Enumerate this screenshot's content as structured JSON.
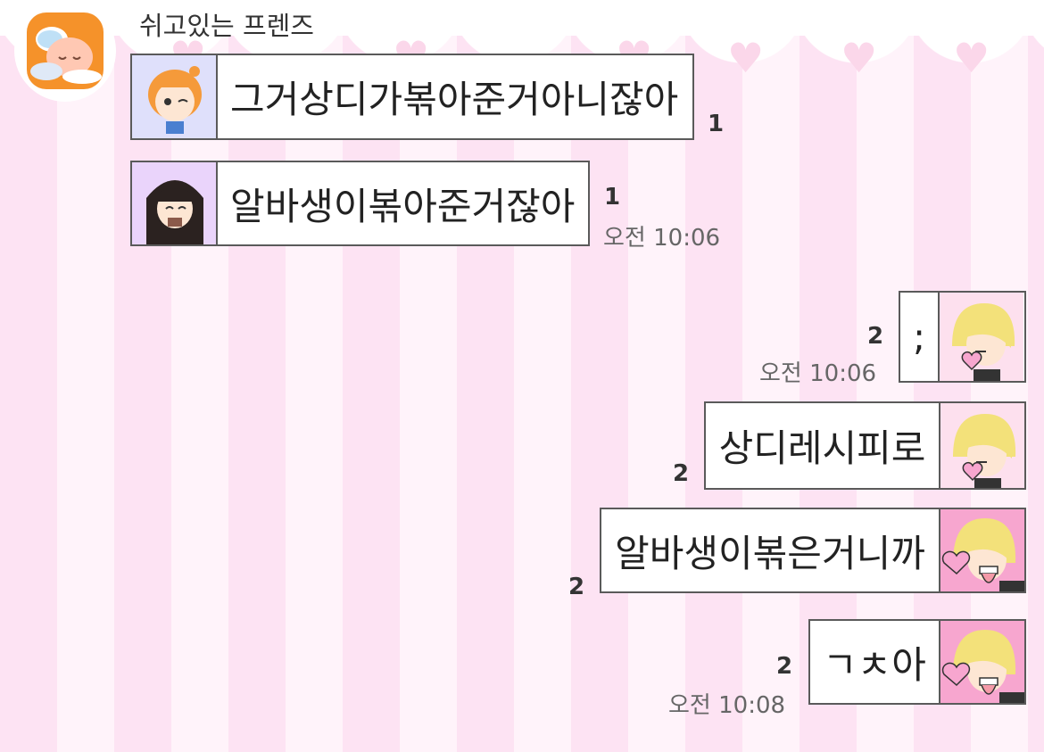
{
  "chat": {
    "sender_name": "쉬고있는 프렌즈",
    "messages": [
      {
        "text": "그거상디가볶아준거아니잖아",
        "count": "1",
        "time": ""
      },
      {
        "text": "알바생이볶아준거잖아",
        "count": "1",
        "time": "오전 10:06"
      },
      {
        "text": ";",
        "count": "2",
        "time": "오전 10:06"
      },
      {
        "text": "상디레시피로",
        "count": "2",
        "time": ""
      },
      {
        "text": "알바생이볶은거니까",
        "count": "2",
        "time": ""
      },
      {
        "text": "ㄱㅊ아",
        "count": "2",
        "time": "오전 10:08"
      }
    ]
  },
  "colors": {
    "stripe_pink": "#fde3f3",
    "stripe_light": "#fff3fa",
    "profile_orange": "#f5922a",
    "avatar_blonde_pink": "#f7a6cf"
  },
  "icons": {
    "profile": "apeach-sleeping-icon",
    "hearts": "heart-icon"
  }
}
